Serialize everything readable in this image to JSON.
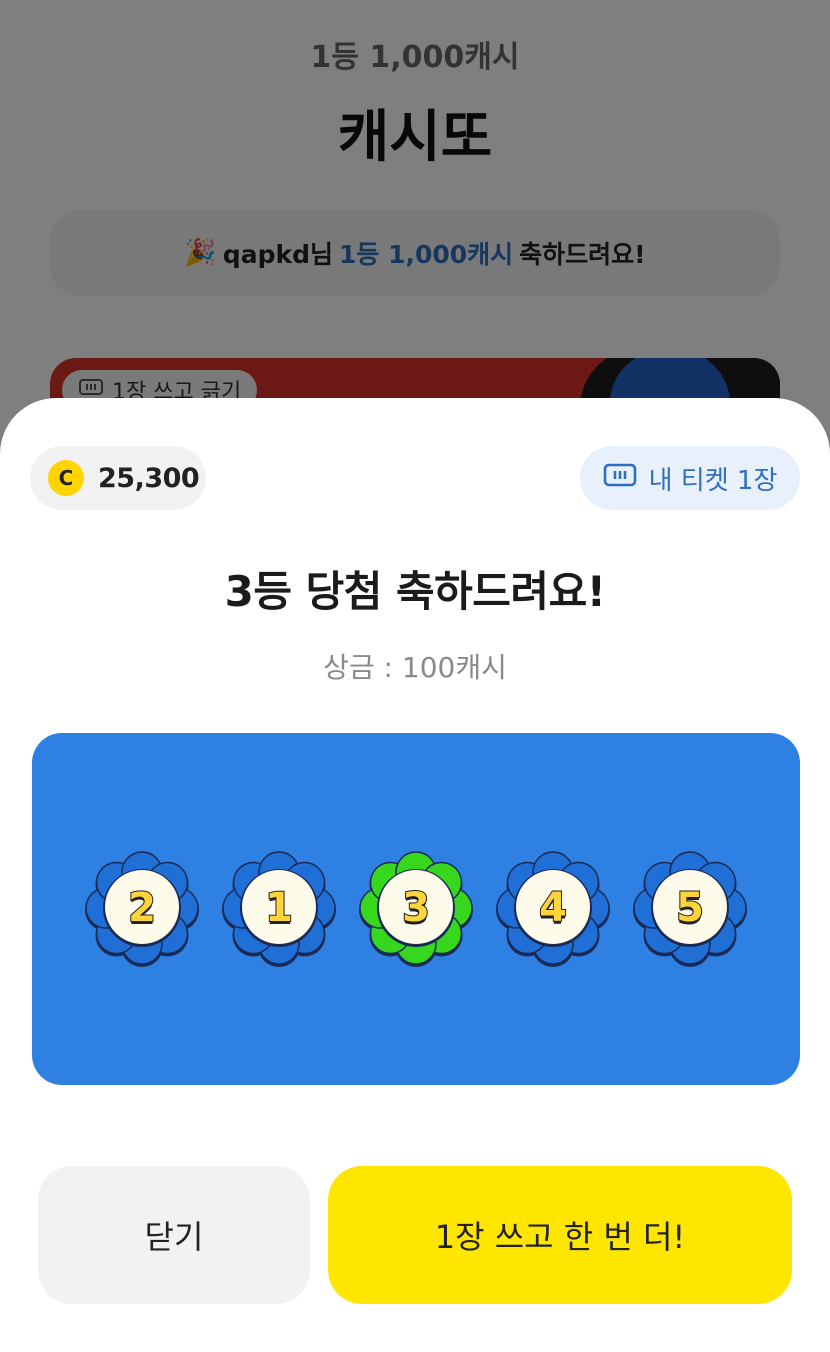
{
  "background": {
    "subtitle": "1등 1,000캐시",
    "title": "캐시또",
    "banner": {
      "emoji": "🎉",
      "user": "qapkd님",
      "prize": "1등 1,000캐시",
      "suffix": "축하드려요!"
    },
    "card_pill_label": "1장 쓰고 긁기"
  },
  "sheet": {
    "coin_icon_letter": "C",
    "coin_balance": "25,300",
    "ticket_label": "내 티켓 1장",
    "headline": "3등 당첨 축하드려요!",
    "prize_text": "상금 : 100캐시",
    "numbers": [
      {
        "value": "2",
        "matched": false
      },
      {
        "value": "1",
        "matched": false
      },
      {
        "value": "3",
        "matched": true
      },
      {
        "value": "4",
        "matched": false
      },
      {
        "value": "5",
        "matched": false
      }
    ],
    "close_button": "닫기",
    "again_button": "1장 쓰고 한 번 더!"
  },
  "colors": {
    "panel": "#2f80e3",
    "petal_default": "#1f6fd6",
    "petal_matched": "#36d71d",
    "again_button": "#ffe600",
    "accent_blue": "#2e6fbf"
  }
}
